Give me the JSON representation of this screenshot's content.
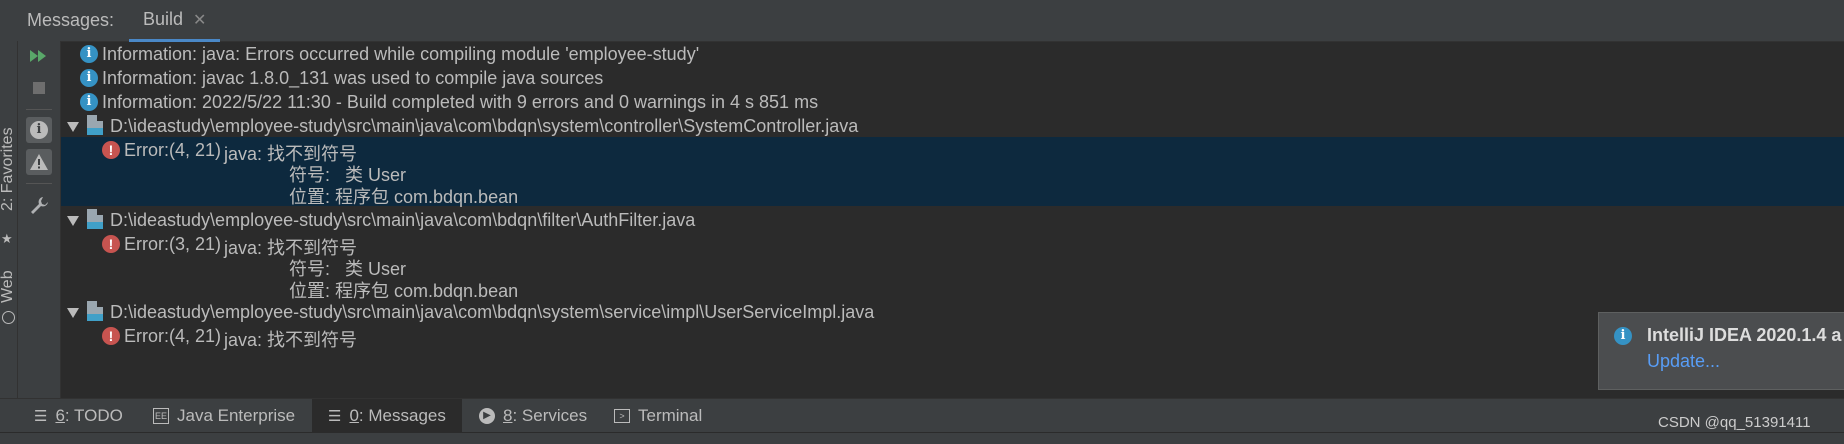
{
  "header": {
    "title": "Messages:",
    "tab_label": "Build"
  },
  "side_panels": [
    {
      "label": "2: Favorites"
    },
    {
      "label": "Web"
    }
  ],
  "messages": [
    {
      "kind": "info",
      "text": "Information: java: Errors occurred while compiling module 'employee-study'"
    },
    {
      "kind": "info",
      "text": "Information: javac 1.8.0_131 was used to compile java sources"
    },
    {
      "kind": "info",
      "text": "Information: 2022/5/22 11:30 - Build completed with 9 errors and 0 warnings in 4 s 851 ms"
    },
    {
      "kind": "file",
      "text": "D:\\ideastudy\\employee-study\\src\\main\\java\\com\\bdqn\\system\\controller\\SystemController.java"
    },
    {
      "kind": "error",
      "location": "Error:(4, 21)",
      "text": "java: 找不到符号"
    },
    {
      "kind": "detail",
      "text": "符号:   类 User"
    },
    {
      "kind": "detail",
      "text": "位置: 程序包 com.bdqn.bean"
    },
    {
      "kind": "file",
      "text": "D:\\ideastudy\\employee-study\\src\\main\\java\\com\\bdqn\\filter\\AuthFilter.java"
    },
    {
      "kind": "error",
      "location": "Error:(3, 21)",
      "text": "java: 找不到符号"
    },
    {
      "kind": "detail",
      "text": "符号:   类 User"
    },
    {
      "kind": "detail",
      "text": "位置: 程序包 com.bdqn.bean"
    },
    {
      "kind": "file",
      "text": "D:\\ideastudy\\employee-study\\src\\main\\java\\com\\bdqn\\system\\service\\impl\\UserServiceImpl.java"
    },
    {
      "kind": "error",
      "location": "Error:(4, 21)",
      "text": "java: 找不到符号"
    }
  ],
  "notification": {
    "title": "IntelliJ IDEA 2020.1.4 a",
    "link": "Update..."
  },
  "bottom_tabs": [
    {
      "mnemonic": "6",
      "label": ": TODO"
    },
    {
      "mnemonic": "",
      "label": "Java Enterprise"
    },
    {
      "mnemonic": "0",
      "label": ": Messages"
    },
    {
      "mnemonic": "8",
      "label": ": Services"
    },
    {
      "mnemonic": "",
      "label": "Terminal"
    }
  ],
  "watermark": "CSDN @qq_51391411",
  "colors": {
    "accent": "#4a88c7",
    "selection": "#0d293e",
    "error": "#c75450",
    "info": "#3592c4",
    "run": "#59a869"
  }
}
